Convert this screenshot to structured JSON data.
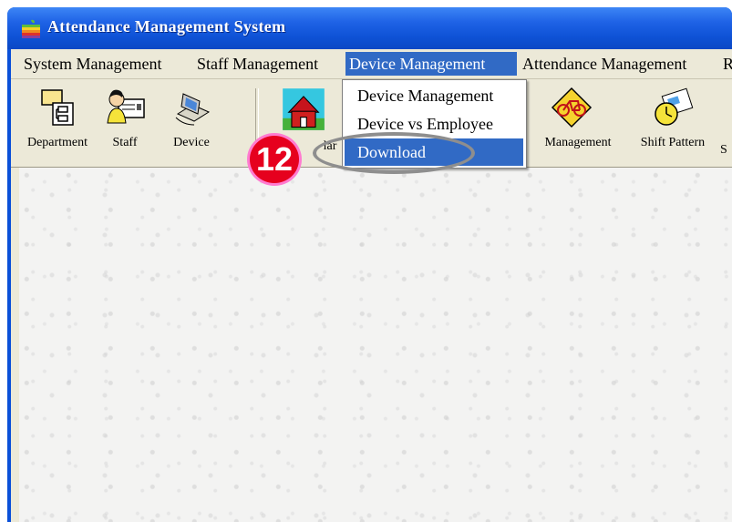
{
  "window": {
    "title": "Attendance Management System"
  },
  "menubar": {
    "items": [
      {
        "label": "System Management"
      },
      {
        "label": "Staff Management"
      },
      {
        "label": "Device Management"
      },
      {
        "label": "Attendance Management"
      },
      {
        "label": "R"
      }
    ]
  },
  "toolbar": {
    "items": [
      {
        "label": "Department",
        "icon": "department-chart-icon"
      },
      {
        "label": "Staff",
        "icon": "staff-id-card-icon"
      },
      {
        "label": "Device",
        "icon": "device-computer-icon"
      },
      {
        "label": "lar",
        "icon": "house-icon"
      },
      {
        "label": "Management",
        "icon": "bicycle-sign-icon"
      },
      {
        "label": "Shift Pattern",
        "icon": "clock-calendar-icon"
      },
      {
        "label": "S"
      }
    ]
  },
  "dropdown": {
    "items": [
      {
        "label": "Device Management"
      },
      {
        "label": "Device vs Employee"
      },
      {
        "label": "Download"
      }
    ],
    "highlighted": "Download"
  },
  "annotation": {
    "step": "12"
  },
  "colors": {
    "title_bar": "#0e52d6",
    "menu_highlight": "#316ac5",
    "badge": "#e6001e",
    "badge_border": "#ff7bd0"
  }
}
